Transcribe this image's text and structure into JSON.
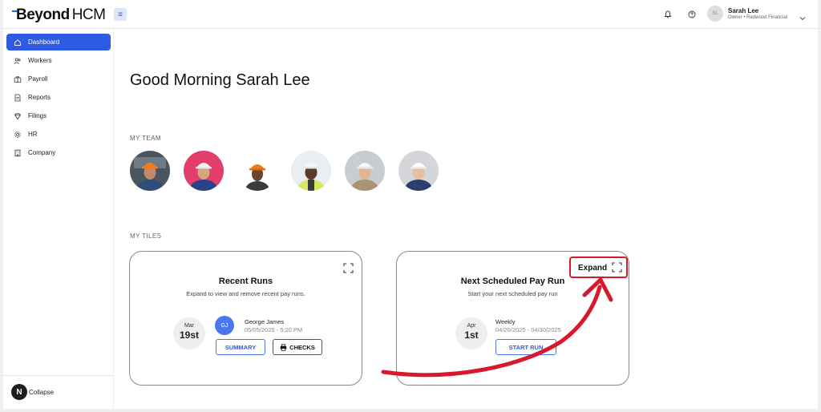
{
  "header": {
    "logo_bold": "Beyond",
    "logo_light": "HCM",
    "user_initials": "SL",
    "user_name": "Sarah Lee",
    "user_subtitle": "Owner • Redwood Financial"
  },
  "sidebar": {
    "items": [
      {
        "label": "Dashboard",
        "icon": "home-icon",
        "active": true
      },
      {
        "label": "Workers",
        "icon": "users-icon"
      },
      {
        "label": "Payroll",
        "icon": "briefcase-icon"
      },
      {
        "label": "Reports",
        "icon": "document-icon"
      },
      {
        "label": "Filings",
        "icon": "gem-icon"
      },
      {
        "label": "HR",
        "icon": "gear-icon"
      },
      {
        "label": "Company",
        "icon": "building-icon"
      }
    ],
    "collapse_badge": "N",
    "collapse_label": "Collapse"
  },
  "main": {
    "greeting": "Good Morning Sarah Lee",
    "team_label": "MY TEAM",
    "tiles_label": "MY TILES"
  },
  "tiles": {
    "recent": {
      "title": "Recent Runs",
      "subtitle": "Expand to view and remove recent pay runs.",
      "month": "Mar",
      "day": "19st",
      "initials": "GJ",
      "name": "George James",
      "meta": "05/05/2025 - 5:20 PM",
      "summary_label": "SUMMARY",
      "checks_label": "CHECKS"
    },
    "next": {
      "title": "Next Scheduled Pay Run",
      "subtitle": "Start your next scheduled pay run",
      "month": "Apr",
      "day": "1st",
      "frequency": "Weekly",
      "period": "04/20/2025 - 04/30/2025",
      "start_label": "START RUN",
      "expand_label": "Expand"
    }
  },
  "colors": {
    "accent": "#2d5be3",
    "callout": "#d8192c"
  }
}
